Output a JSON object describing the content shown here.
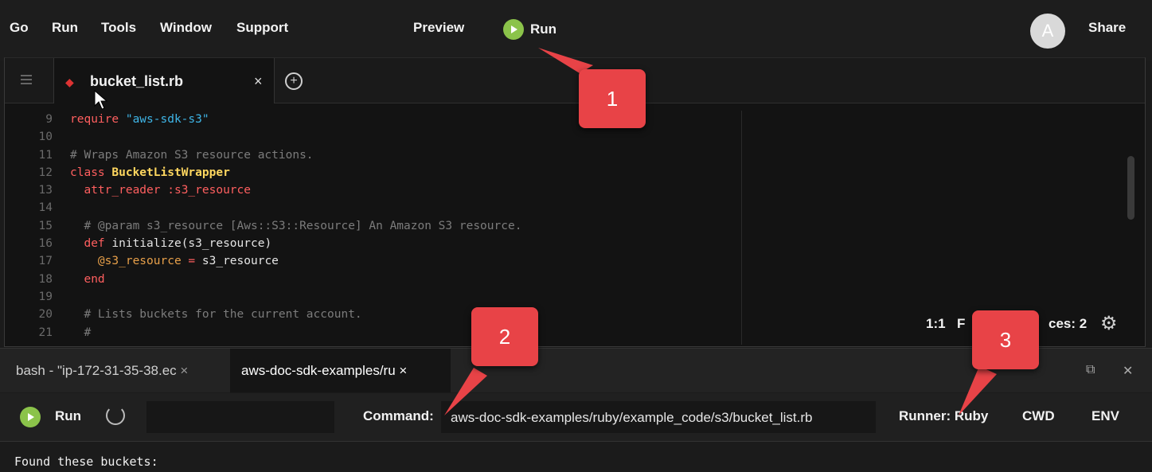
{
  "menubar": {
    "items": [
      "Go",
      "Run",
      "Tools",
      "Window",
      "Support"
    ],
    "preview_label": "Preview",
    "run_label": "Run",
    "avatar_initial": "A",
    "share_label": "Share"
  },
  "editor": {
    "tab_label": "bucket_list.rb",
    "tab_close": "×",
    "code_lines": [
      {
        "n": "9",
        "t": "require \"aws-sdk-s3\""
      },
      {
        "n": "10",
        "t": ""
      },
      {
        "n": "11",
        "t": "# Wraps Amazon S3 resource actions."
      },
      {
        "n": "12",
        "t": "class BucketListWrapper"
      },
      {
        "n": "13",
        "t": "  attr_reader :s3_resource"
      },
      {
        "n": "14",
        "t": ""
      },
      {
        "n": "15",
        "t": "  # @param s3_resource [Aws::S3::Resource] An Amazon S3 resource."
      },
      {
        "n": "16",
        "t": "  def initialize(s3_resource)"
      },
      {
        "n": "17",
        "t": "    @s3_resource = s3_resource"
      },
      {
        "n": "18",
        "t": "  end"
      },
      {
        "n": "19",
        "t": ""
      },
      {
        "n": "20",
        "t": "  # Lists buckets for the current account."
      },
      {
        "n": "21",
        "t": "  #"
      }
    ],
    "status_position": "1:1",
    "status_spaces_prefix": "F",
    "status_spaces_suffix": "ces: 2"
  },
  "terminal": {
    "tab1_label": "bash - \"ip-172-31-35-38.ec",
    "tab2_label": "aws-doc-sdk-examples/ru",
    "tab_close": "×",
    "run_label": "Run",
    "command_label": "Command:",
    "command_value": "aws-doc-sdk-examples/ruby/example_code/s3/bucket_list.rb",
    "runner_label": "Runner: Ruby",
    "cwd_label": "CWD",
    "env_label": "ENV",
    "output": "Found these buckets:"
  },
  "callouts": [
    "1",
    "2",
    "3"
  ],
  "colors": {
    "run_green": "#8bc34a",
    "callout_red": "#e84347",
    "keyword": "#ff5f5f",
    "string": "#3fb6e8",
    "comment": "#7c7c7c",
    "variable": "#e8a04a"
  }
}
